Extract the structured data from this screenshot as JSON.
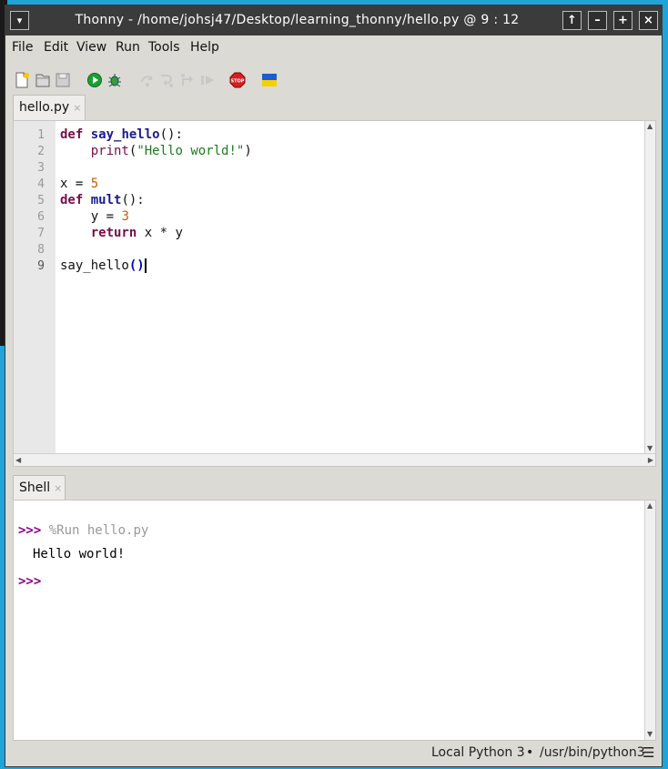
{
  "window": {
    "title": "Thonny  -  /home/johsj47/Desktop/learning_thonny/hello.py  @  9 : 12",
    "controls": [
      "▾",
      "↑",
      "–",
      "+",
      "×"
    ]
  },
  "menu": [
    "File",
    "Edit",
    "View",
    "Run",
    "Tools",
    "Help"
  ],
  "toolbar": {
    "icons": [
      "new-file-icon",
      "open-file-icon",
      "save-file-icon",
      "run-icon",
      "debug-icon",
      "step-over-icon",
      "step-into-icon",
      "step-out-icon",
      "resume-icon",
      "stop-icon",
      "flag-icon"
    ],
    "stop_label": "STOP"
  },
  "editor": {
    "tab": "hello.py",
    "tab_close": "×",
    "line_numbers": [
      "1",
      "2",
      "3",
      "4",
      "5",
      "6",
      "7",
      "8",
      "9"
    ]
  },
  "shell": {
    "tab": "Shell",
    "tab_close": "×",
    "prompt": ">>>",
    "command": "%Run hello.py",
    "output": "Hello world!",
    "prompt2": ">>>"
  },
  "status": {
    "interpreter": "Local Python 3",
    "bullet": "•",
    "path": "/usr/bin/python3",
    "menu": "☰"
  }
}
